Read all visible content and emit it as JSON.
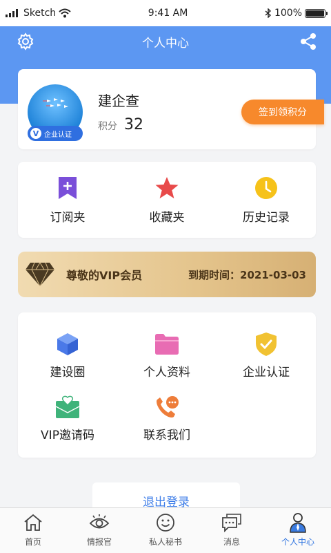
{
  "status_bar": {
    "carrier": "Sketch",
    "time": "9:41 AM",
    "battery": "100%"
  },
  "header": {
    "title": "个人中心"
  },
  "profile": {
    "name": "建企查",
    "badge": "企业认证",
    "points_label": "积分",
    "points_value": "32",
    "checkin_label": "签到领积分"
  },
  "quick_links": [
    {
      "label": "订阅夹",
      "icon": "bookmark-plus-icon"
    },
    {
      "label": "收藏夹",
      "icon": "star-icon"
    },
    {
      "label": "历史记录",
      "icon": "clock-icon"
    }
  ],
  "vip": {
    "title": "尊敬的VIP会员",
    "expiry": "到期时间：2021-03-03"
  },
  "features": [
    {
      "label": "建设圈",
      "icon": "cube-icon"
    },
    {
      "label": "个人资料",
      "icon": "folder-icon"
    },
    {
      "label": "企业认证",
      "icon": "shield-check-icon"
    },
    {
      "label": "VIP邀请码",
      "icon": "envelope-heart-icon"
    },
    {
      "label": "联系我们",
      "icon": "phone-chat-icon"
    }
  ],
  "logout_label": "退出登录",
  "nav": [
    {
      "label": "首页",
      "icon": "home-icon"
    },
    {
      "label": "情报官",
      "icon": "eye-icon"
    },
    {
      "label": "私人秘书",
      "icon": "smile-icon"
    },
    {
      "label": "消息",
      "icon": "message-icon"
    },
    {
      "label": "个人中心",
      "icon": "user-icon",
      "active": true
    }
  ],
  "colors": {
    "brand": "#5c97f2",
    "accent_orange": "#f7892c",
    "active_nav": "#2f74e0"
  }
}
